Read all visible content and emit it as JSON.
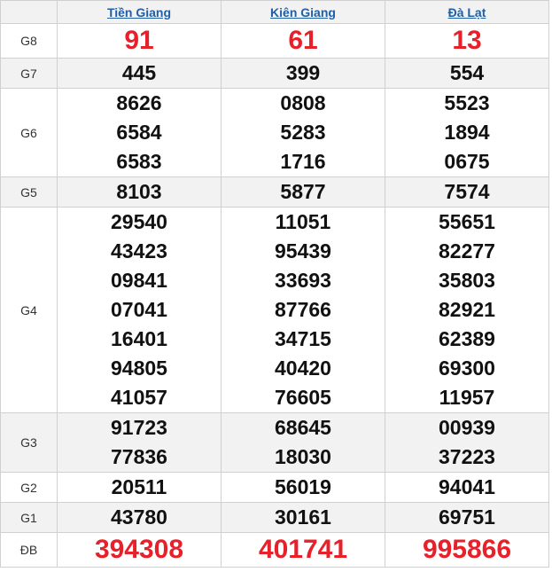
{
  "provinces": [
    "Tiền Giang",
    "Kiên Giang",
    "Đà Lạt"
  ],
  "rows": [
    {
      "label": "G8",
      "values": [
        [
          "91"
        ],
        [
          "61"
        ],
        [
          "13"
        ]
      ]
    },
    {
      "label": "G7",
      "values": [
        [
          "445"
        ],
        [
          "399"
        ],
        [
          "554"
        ]
      ]
    },
    {
      "label": "G6",
      "values": [
        [
          "8626",
          "6584",
          "6583"
        ],
        [
          "0808",
          "5283",
          "1716"
        ],
        [
          "5523",
          "1894",
          "0675"
        ]
      ]
    },
    {
      "label": "G5",
      "values": [
        [
          "8103"
        ],
        [
          "5877"
        ],
        [
          "7574"
        ]
      ]
    },
    {
      "label": "G4",
      "values": [
        [
          "29540",
          "43423",
          "09841",
          "07041",
          "16401",
          "94805",
          "41057"
        ],
        [
          "11051",
          "95439",
          "33693",
          "87766",
          "34715",
          "40420",
          "76605"
        ],
        [
          "55651",
          "82277",
          "35803",
          "82921",
          "62389",
          "69300",
          "11957"
        ]
      ]
    },
    {
      "label": "G3",
      "values": [
        [
          "91723",
          "77836"
        ],
        [
          "68645",
          "18030"
        ],
        [
          "00939",
          "37223"
        ]
      ]
    },
    {
      "label": "G2",
      "values": [
        [
          "20511"
        ],
        [
          "56019"
        ],
        [
          "94041"
        ]
      ]
    },
    {
      "label": "G1",
      "values": [
        [
          "43780"
        ],
        [
          "30161"
        ],
        [
          "69751"
        ]
      ]
    },
    {
      "label": "ĐB",
      "values": [
        [
          "394308"
        ],
        [
          "401741"
        ],
        [
          "995866"
        ]
      ]
    }
  ],
  "colors": {
    "highlight_red": "#e8202a",
    "link_blue": "#1f5fa8",
    "shade": "#f2f2f2",
    "border": "#d0d0d0"
  }
}
